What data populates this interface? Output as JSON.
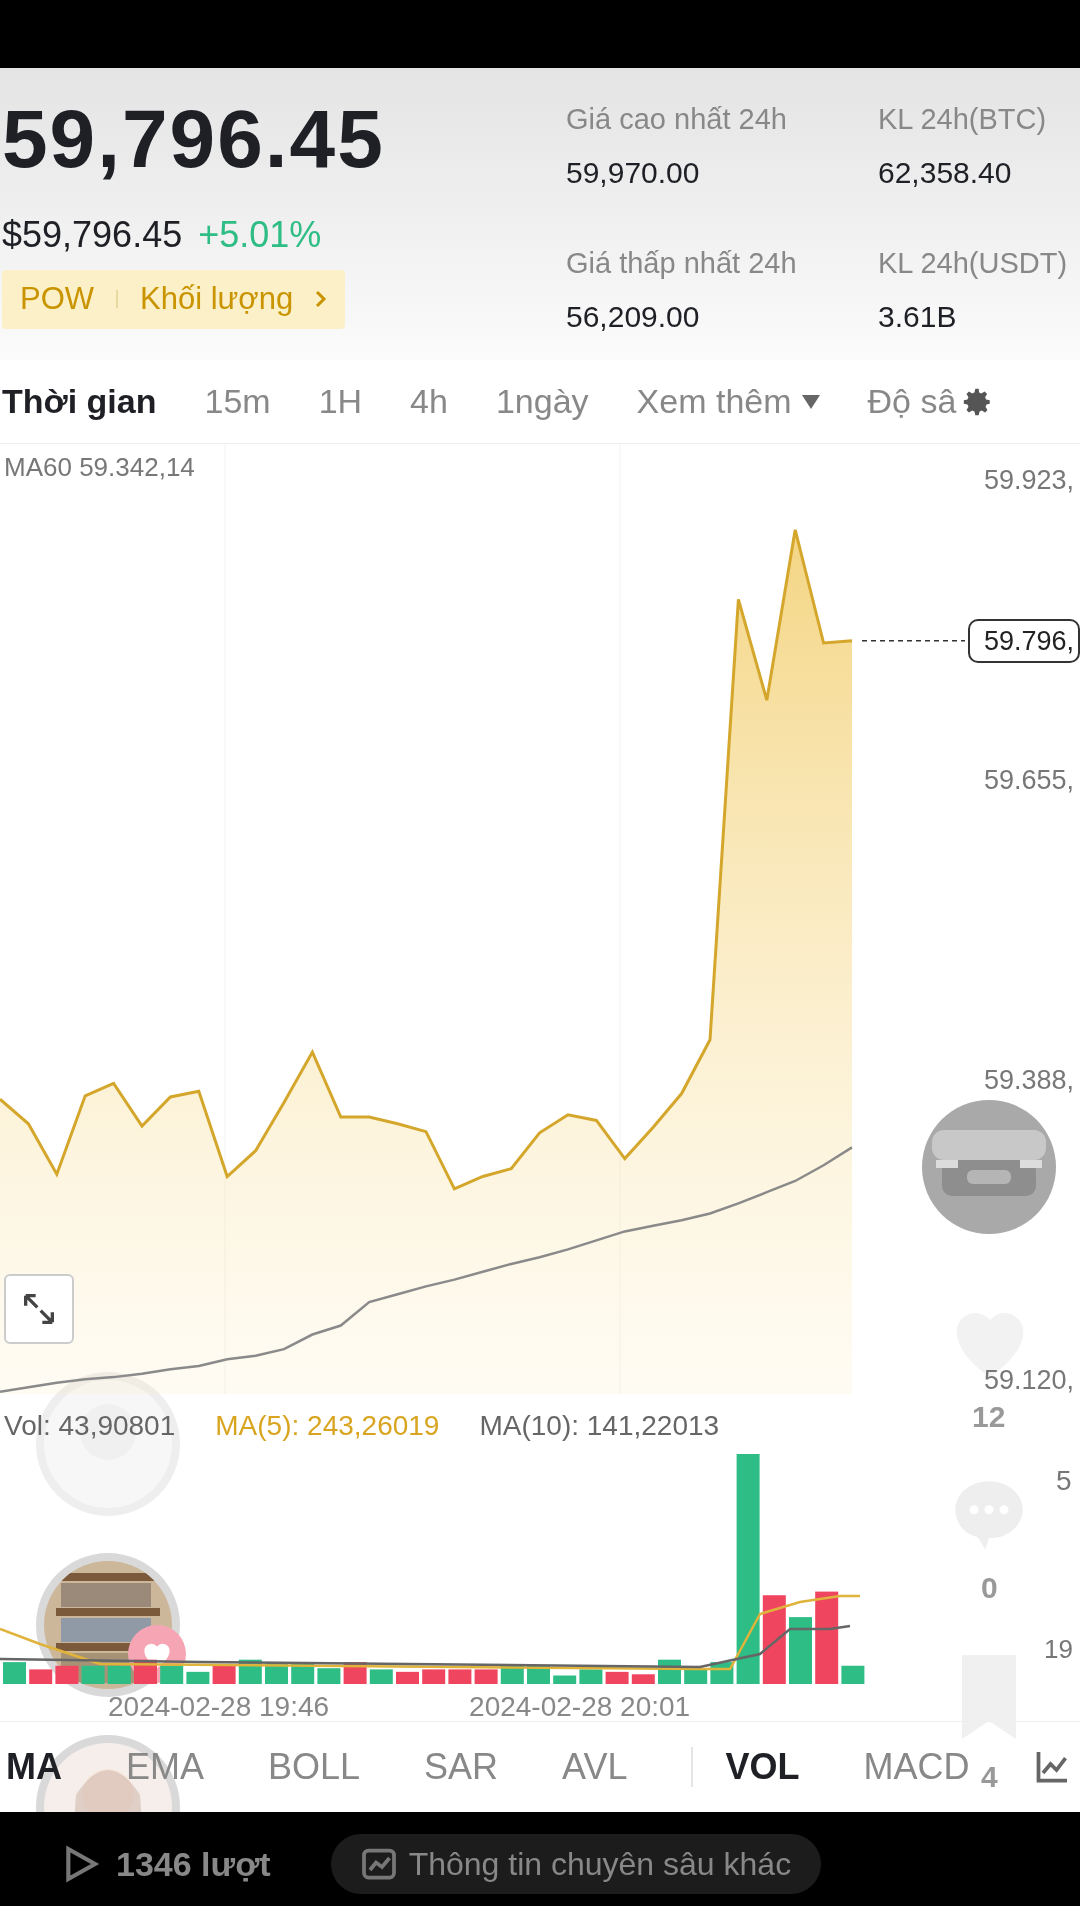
{
  "header": {
    "price": "59,796.45",
    "fiat_price": "$59,796.45",
    "change": "+5.01%",
    "tags": [
      "POW",
      "Khối lượng"
    ],
    "stats": [
      {
        "label": "Giá cao nhất 24h",
        "value": "59,970.00"
      },
      {
        "label": "KL 24h(BTC)",
        "value": "62,358.40"
      },
      {
        "label": "Giá thấp nhất 24h",
        "value": "56,209.00"
      },
      {
        "label": "KL 24h(USDT)",
        "value": "3.61B"
      }
    ]
  },
  "time_tabs": [
    {
      "label": "Thời gian",
      "selected": true
    },
    {
      "label": "15m",
      "selected": false
    },
    {
      "label": "1H",
      "selected": false
    },
    {
      "label": "4h",
      "selected": false
    },
    {
      "label": "1ngày",
      "selected": false
    },
    {
      "label": "Xem thêm",
      "selected": false,
      "kind": "dropdown"
    },
    {
      "label": "Độ sâ",
      "selected": false,
      "kind": "settings"
    }
  ],
  "price_chart": {
    "ma_label": "MA60 59.342,14",
    "last_price_label": "59.796,",
    "y_axis_labels": [
      "59.923,",
      "59.655,",
      "59.388,",
      "59.120,"
    ]
  },
  "volume": {
    "vol_label": "Vol: 43,90801",
    "ma5_label": "MA(5): 243,26019",
    "ma10_label": "MA(10): 141,22013",
    "axis_labels": [
      "5",
      "19"
    ],
    "dates": [
      "2024-02-28 19:46",
      "2024-02-28 20:01"
    ]
  },
  "indicator_tabs": [
    {
      "label": "MA",
      "selected": true
    },
    {
      "label": "EMA",
      "selected": false
    },
    {
      "label": "BOLL",
      "selected": false
    },
    {
      "label": "SAR",
      "selected": false
    },
    {
      "label": "AVL",
      "selected": false
    },
    {
      "label": "VOL",
      "selected": true,
      "kind": "divided"
    },
    {
      "label": "MACD",
      "selected": false
    }
  ],
  "video_overlay": {
    "like_count": "12",
    "comment_count": "0",
    "save_count": "4",
    "views": "1346 lượt",
    "more_info": "Thông tin chuyên sâu khác"
  }
}
